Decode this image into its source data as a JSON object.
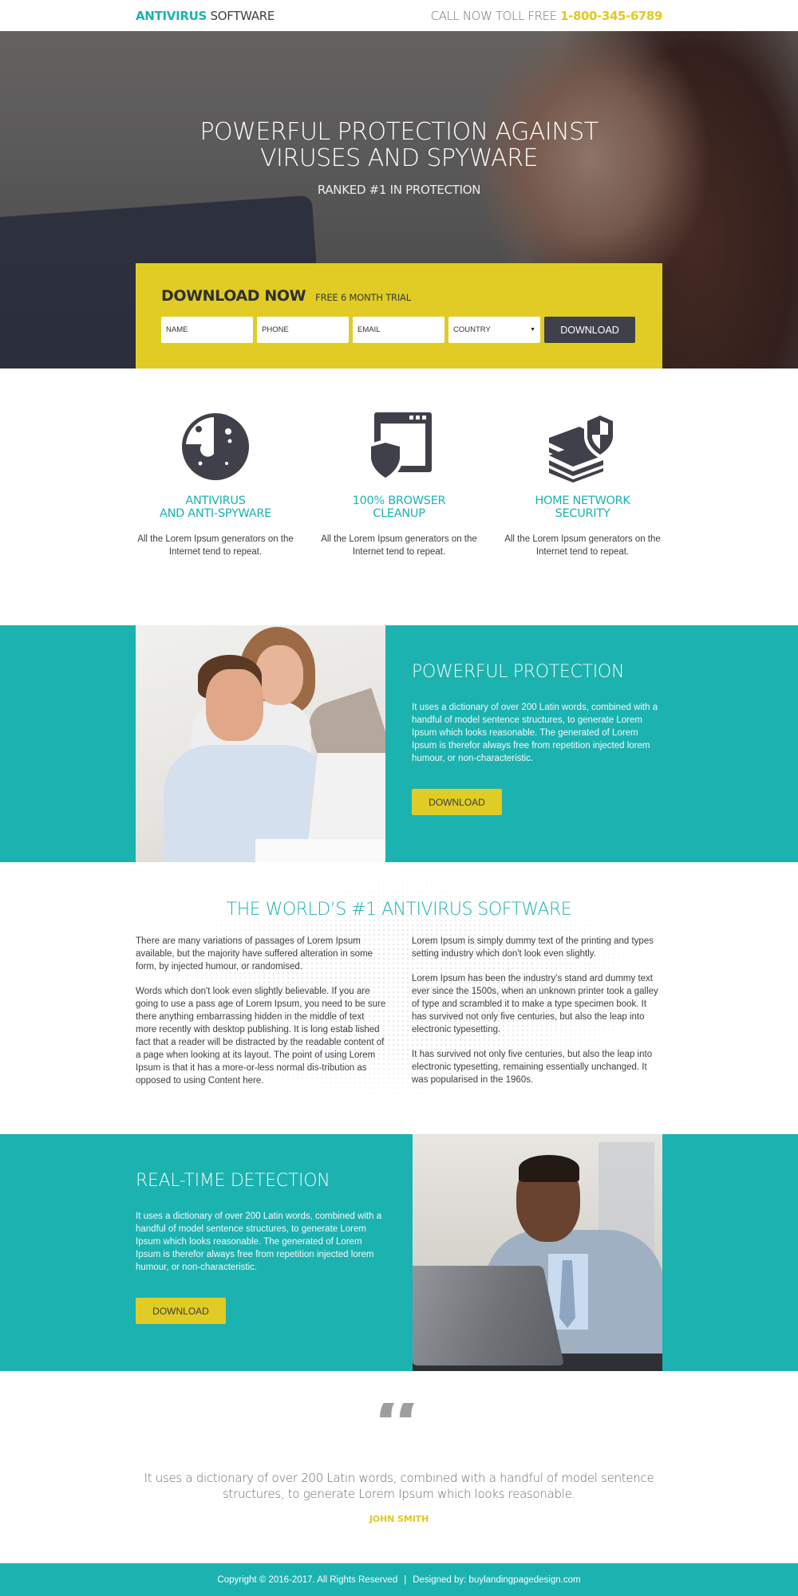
{
  "colors": {
    "teal": "#1cb2b0",
    "yellow": "#e1cc25",
    "dark": "#40404b",
    "phone_accent": "#e2c81f"
  },
  "header": {
    "logo_accent": "ANTIVIRUS",
    "logo_rest": " SOFTWARE",
    "call_label": "CALL NOW TOLL FREE ",
    "phone": "1-800-345-6789"
  },
  "hero": {
    "title_line1": "POWERFUL PROTECTION AGAINST",
    "title_line2": "VIRUSES AND SPYWARE",
    "subtitle": "RANKED #1 IN PROTECTION"
  },
  "download_form": {
    "title": "DOWNLOAD NOW",
    "trial": "FREE 6 MONTH TRIAL",
    "fields": {
      "name_placeholder": "NAME",
      "phone_placeholder": "PHONE",
      "email_placeholder": "EMAIL",
      "country_selected": "COUNTRY"
    },
    "submit_label": "DOWNLOAD"
  },
  "features": [
    {
      "icon": "radar-icon",
      "title_line1": "ANTIVIRUS",
      "title_line2": "AND ANTI-SPYWARE",
      "desc": "All the Lorem Ipsum generators on the Internet tend to repeat."
    },
    {
      "icon": "browser-shield-icon",
      "title_line1": "100% BROWSER",
      "title_line2": "CLEANUP",
      "desc": "All the Lorem Ipsum generators on the Internet tend to repeat."
    },
    {
      "icon": "network-shield-icon",
      "title_line1": "HOME NETWORK",
      "title_line2": "SECURITY",
      "desc": "All the Lorem Ipsum generators on the Internet tend to repeat."
    }
  ],
  "protection": {
    "title": "POWERFUL PROTECTION",
    "text": "It uses a dictionary of over 200 Latin words, combined with a handful of model sentence structures, to generate Lorem Ipsum which looks reasonable. The generated of Lorem Ipsum is therefor always free from repetition injected lorem humour, or non-characteristic.",
    "button": "DOWNLOAD",
    "photo": "couple-at-laptop-photo"
  },
  "world": {
    "title": "THE WORLD’S #1 ANTIVIRUS SOFTWARE",
    "left": [
      "There are many variations of passages of Lorem Ipsum available, but the majority have suffered alteration in some form, by injected humour, or randomised.",
      "Words which don't look even slightly believable. If you are going to use a pass age of Lorem Ipsum, you need to be sure there anything embarrassing hidden in the middle of text more recently with desktop publishing. It is long estab lished fact that a reader will be distracted by the readable content of a page when looking at its layout. The point of using Lorem Ipsum is that it has a more-or-less normal dis-tribution as opposed to using Content here."
    ],
    "right": [
      "Lorem Ipsum is simply dummy text of the printing and types setting industry which don't look even slightly.",
      "Lorem Ipsum has been the industry's stand ard dummy text ever since the 1500s, when an unknown printer took a galley of type and scrambled it to make a type specimen book. It has survived not only five centuries, but also the leap into electronic typesetting.",
      "It has survived not only five centuries, but also the leap into electronic typesetting, remaining essentially unchanged. It was popularised in the 1960s."
    ]
  },
  "detection": {
    "title": "REAL-TIME DETECTION",
    "text": "It uses a dictionary of over 200 Latin words, combined with a handful of model sentence structures, to generate Lorem Ipsum which looks reasonable. The generated of Lorem Ipsum is therefor always free from repetition injected lorem humour, or non-characteristic.",
    "button": "DOWNLOAD",
    "photo": "businessman-at-laptop-photo"
  },
  "testimonial": {
    "quote_glyph": "“",
    "text": "It uses a dictionary of over 200 Latin words, combined with a handful of model sentence structures, to generate Lorem Ipsum which looks reasonable.",
    "author": "JOHN SMITH"
  },
  "footer": {
    "copyright": "Copyright © 2016-2017. All Rights Reserved",
    "separator": "|",
    "designed_by": "Designed by: buylandingpagedesign.com"
  }
}
